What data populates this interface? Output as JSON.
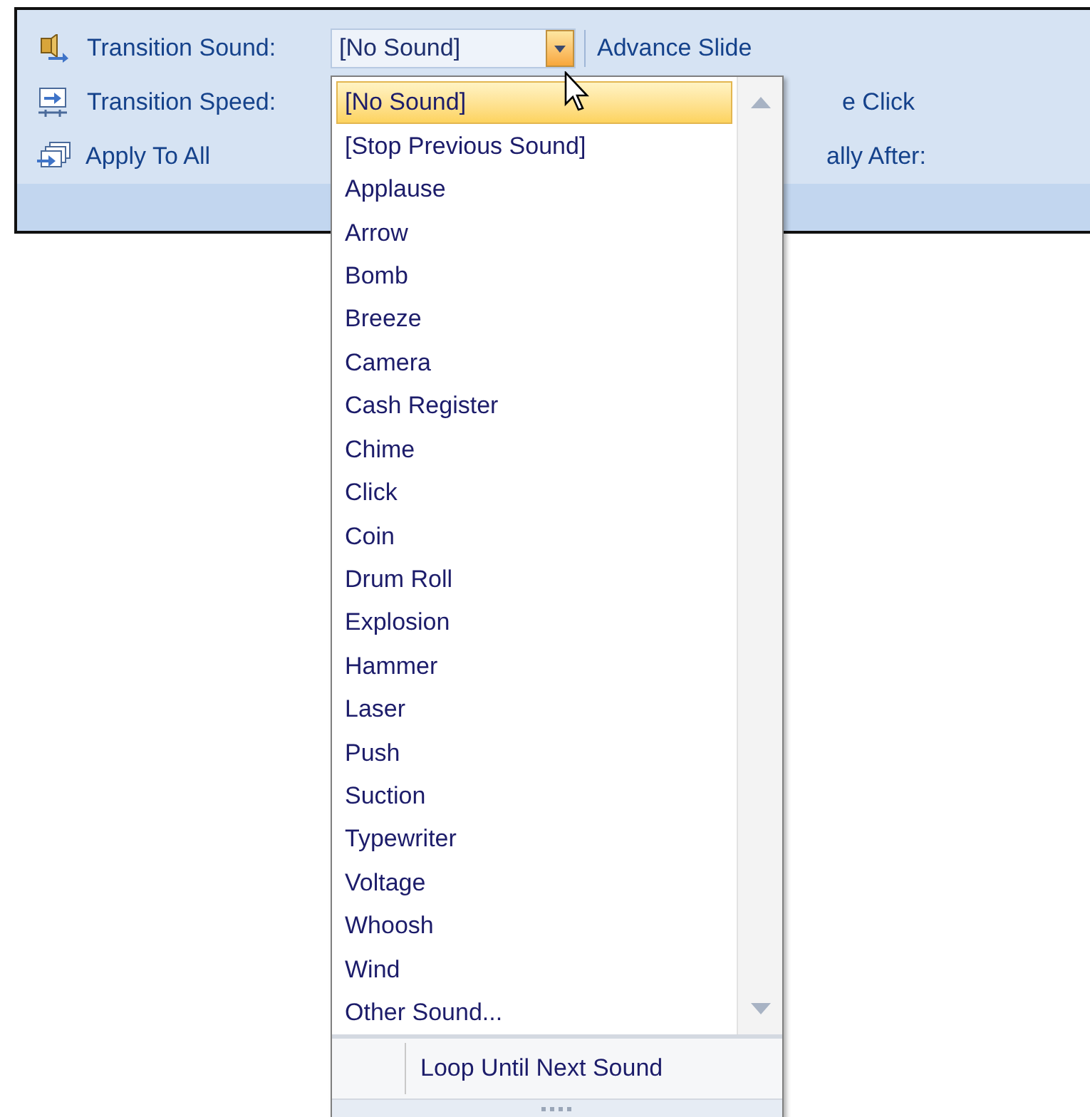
{
  "ribbon": {
    "transition_sound": {
      "label": "Transition Sound:",
      "value": "[No Sound]"
    },
    "transition_speed": {
      "label": "Transition Speed:"
    },
    "apply_to_all": {
      "label": "Apply To All"
    },
    "advance_slide": {
      "label": "Advance Slide"
    },
    "advance_option_1": {
      "label": "e Click"
    },
    "advance_option_2": {
      "label": "ally After:"
    }
  },
  "dropdown": {
    "items": [
      {
        "label": "[No Sound]",
        "selected": true
      },
      {
        "label": "[Stop Previous Sound]",
        "selected": false
      },
      {
        "label": "Applause",
        "selected": false
      },
      {
        "label": "Arrow",
        "selected": false
      },
      {
        "label": "Bomb",
        "selected": false
      },
      {
        "label": "Breeze",
        "selected": false
      },
      {
        "label": "Camera",
        "selected": false
      },
      {
        "label": "Cash Register",
        "selected": false
      },
      {
        "label": "Chime",
        "selected": false
      },
      {
        "label": "Click",
        "selected": false
      },
      {
        "label": "Coin",
        "selected": false
      },
      {
        "label": "Drum Roll",
        "selected": false
      },
      {
        "label": "Explosion",
        "selected": false
      },
      {
        "label": "Hammer",
        "selected": false
      },
      {
        "label": "Laser",
        "selected": false
      },
      {
        "label": "Push",
        "selected": false
      },
      {
        "label": "Suction",
        "selected": false
      },
      {
        "label": "Typewriter",
        "selected": false
      },
      {
        "label": "Voltage",
        "selected": false
      },
      {
        "label": "Whoosh",
        "selected": false
      },
      {
        "label": "Wind",
        "selected": false
      },
      {
        "label": "Other Sound...",
        "selected": false
      }
    ],
    "footer_item": {
      "label": "Loop Until Next Sound"
    }
  }
}
